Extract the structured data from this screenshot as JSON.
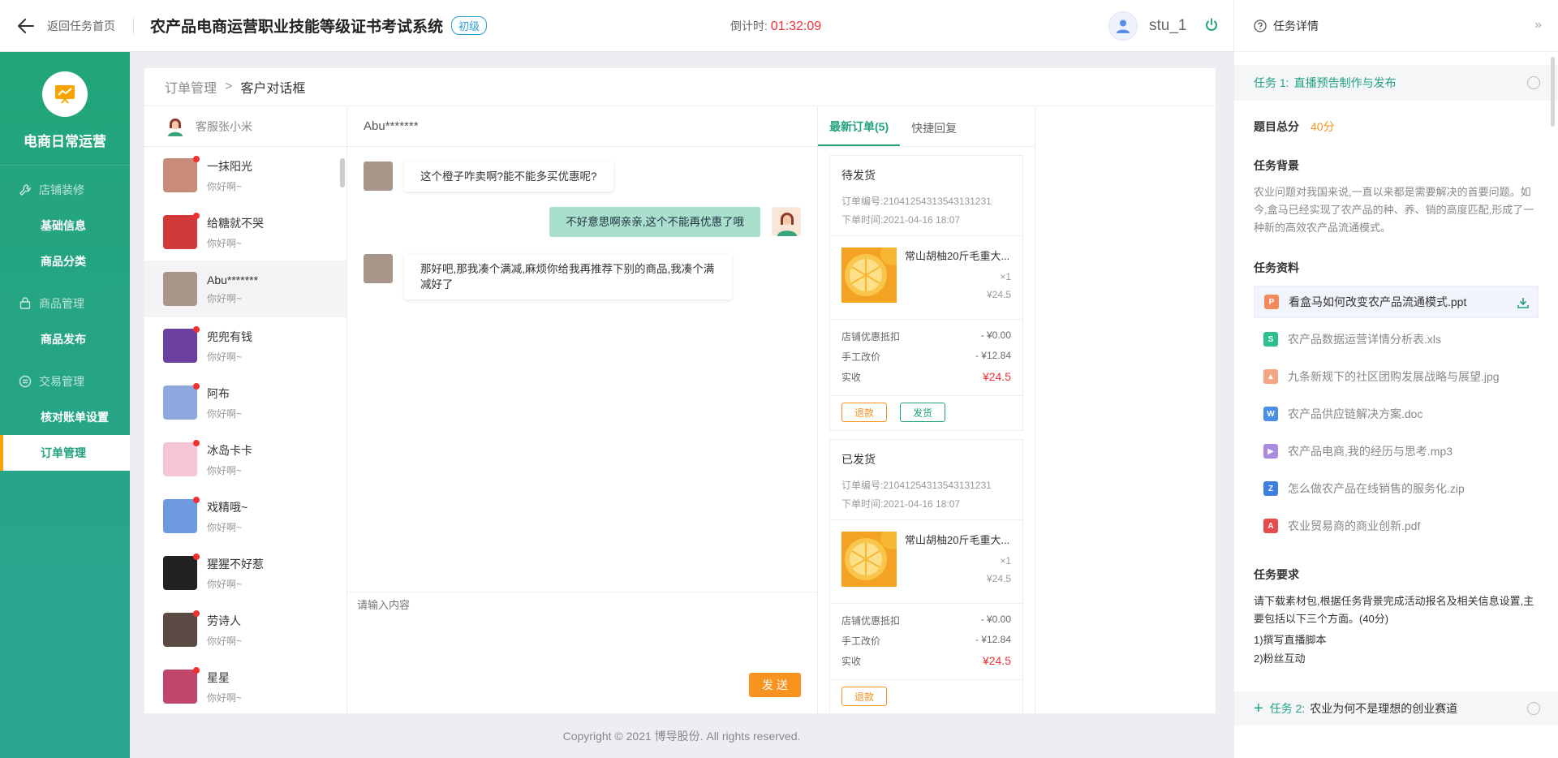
{
  "header": {
    "back_label": "返回任务首页",
    "system_title": "农产品电商运营职业技能等级证书考试系统",
    "level_badge": "初级",
    "countdown_label": "倒计时:",
    "countdown_time": "01:32:09",
    "username": "stu_1"
  },
  "sidebar": {
    "brand": "电商日常运营",
    "groups": [
      {
        "label": "店铺装修",
        "items": [
          "基础信息",
          "商品分类"
        ]
      },
      {
        "label": "商品管理",
        "items": [
          "商品发布"
        ]
      },
      {
        "label": "交易管理",
        "items": [
          "核对账单设置",
          "订单管理"
        ]
      }
    ],
    "active_item": "订单管理"
  },
  "breadcrumb": {
    "parent": "订单管理",
    "separator": ">",
    "current": "客户对话框"
  },
  "agent": {
    "name": "客服张小米"
  },
  "contacts": [
    {
      "name": "一抹阳光",
      "msg": "你好啊~",
      "color": "#c98b7a"
    },
    {
      "name": "给糖就不哭",
      "msg": "你好啊~",
      "color": "#d23a3a"
    },
    {
      "name": "Abu*******",
      "msg": "你好啊~",
      "color": "#a8968a"
    },
    {
      "name": "兜兜有钱",
      "msg": "你好啊~",
      "color": "#6a3fa0"
    },
    {
      "name": "阿布",
      "msg": "你好啊~",
      "color": "#8fa8e0"
    },
    {
      "name": "冰岛卡卡",
      "msg": "你好啊~",
      "color": "#f5c6d3"
    },
    {
      "name": "戏精哦~",
      "msg": "你好啊~",
      "color": "#6e9be0"
    },
    {
      "name": "猩猩不好惹",
      "msg": "你好啊~",
      "color": "#222222"
    },
    {
      "name": "劳诗人",
      "msg": "你好啊~",
      "color": "#5b4a44"
    },
    {
      "name": "星星",
      "msg": "你好啊~",
      "color": "#c0466b"
    }
  ],
  "chat": {
    "contact_name": "Abu*******",
    "messages": [
      {
        "side": "left",
        "text": "这个橙子咋卖啊?能不能多买优惠呢?"
      },
      {
        "side": "right",
        "text": "不好意思啊亲亲,这个不能再优惠了哦"
      },
      {
        "side": "left",
        "text": "那好吧,那我凑个满减,麻烦你给我再推荐下别的商品,我凑个满减好了"
      }
    ],
    "input_placeholder": "请输入内容",
    "send_label": "发 送"
  },
  "orders": {
    "tabs": [
      "最新订单(5)",
      "快捷回复"
    ],
    "cards": [
      {
        "status": "待发货",
        "order_no": "订单编号:21041254313543131231",
        "time": "下单时间:2021-04-16  18:07",
        "product_name": "常山胡柚20斤毛重大...",
        "qty": "×1",
        "price": "¥24.5",
        "fees": [
          {
            "label": "店铺优惠抵扣",
            "value": "- ¥0.00"
          },
          {
            "label": "手工改价",
            "value": "- ¥12.84"
          },
          {
            "label": "实收",
            "value": "¥24.5"
          }
        ],
        "buttons": [
          "退款",
          "发货"
        ]
      },
      {
        "status": "已发货",
        "order_no": "订单编号:21041254313543131231",
        "time": "下单时间:2021-04-16  18:07",
        "product_name": "常山胡柚20斤毛重大...",
        "qty": "×1",
        "price": "¥24.5",
        "fees": [
          {
            "label": "店铺优惠抵扣",
            "value": "- ¥0.00"
          },
          {
            "label": "手工改价",
            "value": "- ¥12.84"
          },
          {
            "label": "实收",
            "value": "¥24.5"
          }
        ],
        "buttons": [
          "退款"
        ]
      }
    ]
  },
  "footer": {
    "copyright": "Copyright © 2021 博导股份. All rights reserved."
  },
  "task_panel": {
    "title": "任务详情",
    "task1_num": "任务 1:",
    "task1_title": "直播预告制作与发布",
    "score_label": "题目总分",
    "score_value": "40分",
    "background_title": "任务背景",
    "background_text": "农业问题对我国来说,一直以来都是需要解决的首要问题。如今,盒马已经实现了农产品的种、养、销的高度匹配,形成了一种新的高效农产品流通模式。",
    "materials_title": "任务资料",
    "files": [
      {
        "name": "看盒马如何改变农产品流通模式.ppt",
        "color": "#f08a5d",
        "glyph": "P"
      },
      {
        "name": "农产品数据运营详情分析表.xls",
        "color": "#2dbf8f",
        "glyph": "S"
      },
      {
        "name": "九条新规下的社区团购发展战略与展望.jpg",
        "color": "#f4a582",
        "glyph": "▲"
      },
      {
        "name": "农产品供应链解决方案.doc",
        "color": "#4a8fe7",
        "glyph": "W"
      },
      {
        "name": "农产品电商,我的经历与思考.mp3",
        "color": "#a98be0",
        "glyph": "▶"
      },
      {
        "name": "怎么做农产品在线销售的服务化.zip",
        "color": "#3f7fe0",
        "glyph": "Z"
      },
      {
        "name": "农业贸易商的商业创新.pdf",
        "color": "#e64a4a",
        "glyph": "A"
      }
    ],
    "requirements_title": "任务要求",
    "requirements_text": "请下载素材包,根据任务背景完成活动报名及相关信息设置,主要包括以下三个方面。(40分)",
    "requirements_items": [
      "1)撰写直播脚本",
      "2)粉丝互动"
    ],
    "task2_num": "任务 2:",
    "task2_title": "农业为何不是理想的创业赛道"
  }
}
